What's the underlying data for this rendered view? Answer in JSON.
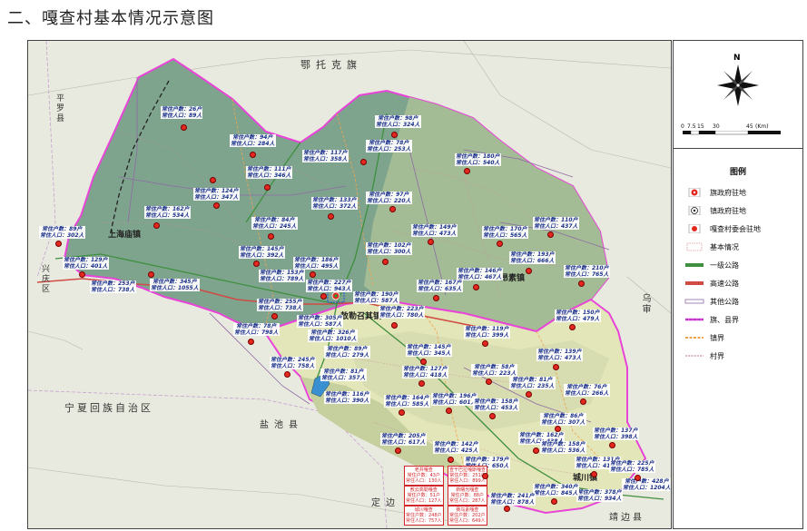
{
  "title": "二、嘎查村基本情况示意图",
  "compass": {
    "north": "N"
  },
  "scale": {
    "ticks": [
      "0",
      "7.5",
      "15",
      "30",
      "45"
    ],
    "unit": "(Km)"
  },
  "legend": {
    "title": "图例",
    "items": [
      "旗政府驻地",
      "镇政府驻地",
      "嘎查村委会驻地",
      "基本情况",
      "一级公路",
      "高速公路",
      "其他公路",
      "旗、县界",
      "镇界",
      "村界"
    ]
  },
  "regions": {
    "ordos": "鄂托克旗",
    "ningxia": "宁夏回族自治区",
    "pingluo": "平罗县",
    "xingqing": "兴庆区",
    "yanchi": "盐池县",
    "dingbian": "定边",
    "jingbian": "靖边县",
    "wushen": "乌审"
  },
  "towns": {
    "shanghaimiao": "上海庙镇",
    "aonanzhen": "敖勒召其镇",
    "angsu": "昂素镇",
    "chengchuan": "城川镇"
  },
  "colors": {
    "forest": "#7fa48e",
    "grass": "#b7c9a0",
    "yellow": "#e3e6b8",
    "border": "#e844d8",
    "road_primary": "#3e8f3e",
    "road_highway": "#cf4b44",
    "label_text": "#1a2f8a",
    "pin": "#e3281f"
  },
  "labels": [
    {
      "hh": "常住户数：26户",
      "pop": "常住人口：89人"
    },
    {
      "hh": "常住户数：98户",
      "pop": "常住人口：324人"
    },
    {
      "hh": "常住户数：94户",
      "pop": "常住人口：284人"
    },
    {
      "hh": "常住户数：117户",
      "pop": "常住人口：358人"
    },
    {
      "hh": "常住户数：78户",
      "pop": "常住人口：253人"
    },
    {
      "hh": "常住户数：180户",
      "pop": "常住人口：540人"
    },
    {
      "hh": "常住户数：111户",
      "pop": "常住人口：346人"
    },
    {
      "hh": "常住户数：124户",
      "pop": "常住人口：347人"
    },
    {
      "hh": "常住户数：133户",
      "pop": "常住人口：372人"
    },
    {
      "hh": "常住户数：97户",
      "pop": "常住人口：220人"
    },
    {
      "hh": "常住户数：162户",
      "pop": "常住人口：534人"
    },
    {
      "hh": "常住户数：84户",
      "pop": "常住人口：245人"
    },
    {
      "hh": "常住户数：149户",
      "pop": "常住人口：473人"
    },
    {
      "hh": "常住户数：170户",
      "pop": "常住人口：565人"
    },
    {
      "hh": "常住户数：110户",
      "pop": "常住人口：437人"
    },
    {
      "hh": "常住户数：89户",
      "pop": "常住人口：302人"
    },
    {
      "hh": "常住户数：145户",
      "pop": "常住人口：392人"
    },
    {
      "hh": "常住户数：102户",
      "pop": "常住人口：300人"
    },
    {
      "hh": "常住户数：129户",
      "pop": "常住人口：401人"
    },
    {
      "hh": "常住户数：186户",
      "pop": "常住人口：495人"
    },
    {
      "hh": "常住户数：193户",
      "pop": "常住人口：666人"
    },
    {
      "hh": "常住户数：153户",
      "pop": "常住人口：789人"
    },
    {
      "hh": "常住户数：146户",
      "pop": "常住人口：467人"
    },
    {
      "hh": "常住户数：210户",
      "pop": "常住人口：765人"
    },
    {
      "hh": "常住户数：345户",
      "pop": "常住人口：1055人"
    },
    {
      "hh": "常住户数：253户",
      "pop": "常住人口：738人"
    },
    {
      "hh": "常住户数：227户",
      "pop": "常住人口：943人"
    },
    {
      "hh": "常住户数：167户",
      "pop": "常住人口：635人"
    },
    {
      "hh": "常住户数：190户",
      "pop": "常住人口：587人"
    },
    {
      "hh": "常住户数：255户",
      "pop": "常住人口：738人"
    },
    {
      "hh": "常住户数：223户",
      "pop": "常住人口：780人"
    },
    {
      "hh": "常住户数：150户",
      "pop": "常住人口：479人"
    },
    {
      "hh": "常住户数：305户",
      "pop": "常住人口：587人"
    },
    {
      "hh": "常住户数：119户",
      "pop": "常住人口：399人"
    },
    {
      "hh": "常住户数：78户",
      "pop": "常住人口：798人"
    },
    {
      "hh": "常住户数：326户",
      "pop": "常住人口：1010人"
    },
    {
      "hh": "常住户数：145户",
      "pop": "常住人口：345人"
    },
    {
      "hh": "常住户数：139户",
      "pop": "常住人口：473人"
    },
    {
      "hh": "常住户数：89户",
      "pop": "常住人口：279人"
    },
    {
      "hh": "常住户数：245户",
      "pop": "常住人口：758人"
    },
    {
      "hh": "常住户数：127户",
      "pop": "常住人口：418人"
    },
    {
      "hh": "常住户数：58户",
      "pop": "常住人口：223人"
    },
    {
      "hh": "常住户数：81户",
      "pop": "常住人口：357人"
    },
    {
      "hh": "常住户数：81户",
      "pop": "常住人口：235人"
    },
    {
      "hh": "常住户数：76户",
      "pop": "常住人口：266人"
    },
    {
      "hh": "常住户数：116户",
      "pop": "常住人口：390人"
    },
    {
      "hh": "常住户数：164户",
      "pop": "常住人口：585人"
    },
    {
      "hh": "常住户数：196户",
      "pop": "常住人口：601人"
    },
    {
      "hh": "常住户数：158户",
      "pop": "常住人口：453人"
    },
    {
      "hh": "常住户数：86户",
      "pop": "常住人口：307人"
    },
    {
      "hh": "常住户数：137户",
      "pop": "常住人口：398人"
    },
    {
      "hh": "常住户数：205户",
      "pop": "常住人口：617人"
    },
    {
      "hh": "常住户数：142户",
      "pop": "常住人口：425人"
    },
    {
      "hh": "常住户数：162户",
      "pop": "常住人口：438人"
    },
    {
      "hh": "常住户数：158户",
      "pop": "常住人口：536人"
    },
    {
      "hh": "常住户数：179户",
      "pop": "常住人口：650人"
    },
    {
      "hh": "常住户数：131户",
      "pop": "常住人口：418人"
    },
    {
      "hh": "常住户数：225户",
      "pop": "常住人口：785人"
    },
    {
      "hh": "常住户数：428户",
      "pop": "常住人口：1204人"
    },
    {
      "hh": "常住户数：378户",
      "pop": "常住人口：934人"
    },
    {
      "hh": "常住户数：340户",
      "pop": "常住人口：845人"
    },
    {
      "hh": "常住户数：241户",
      "pop": "常住人口：878人"
    }
  ],
  "red_boxes": [
    {
      "name": "老井嘎查",
      "hh": "常住户数：43户",
      "pop": "常住人口：130人"
    },
    {
      "name": "查干巴拉嘎斯嘎查",
      "hh": "常住户数：251户",
      "pop": "常住人口：899人"
    },
    {
      "name": "敖云高勒嘎查",
      "hh": "常住户数：51户",
      "pop": "常住人口：127人"
    },
    {
      "name": "新曙光嘎查",
      "hh": "常住户数：88户",
      "pop": "常住人口：287人"
    },
    {
      "name": "城川嘎查",
      "hh": "常住户数：248户",
      "pop": "常住人口：757人"
    },
    {
      "name": "赛乌素嘎查",
      "hh": "常住户数：202户",
      "pop": "常住人口：649人"
    }
  ]
}
